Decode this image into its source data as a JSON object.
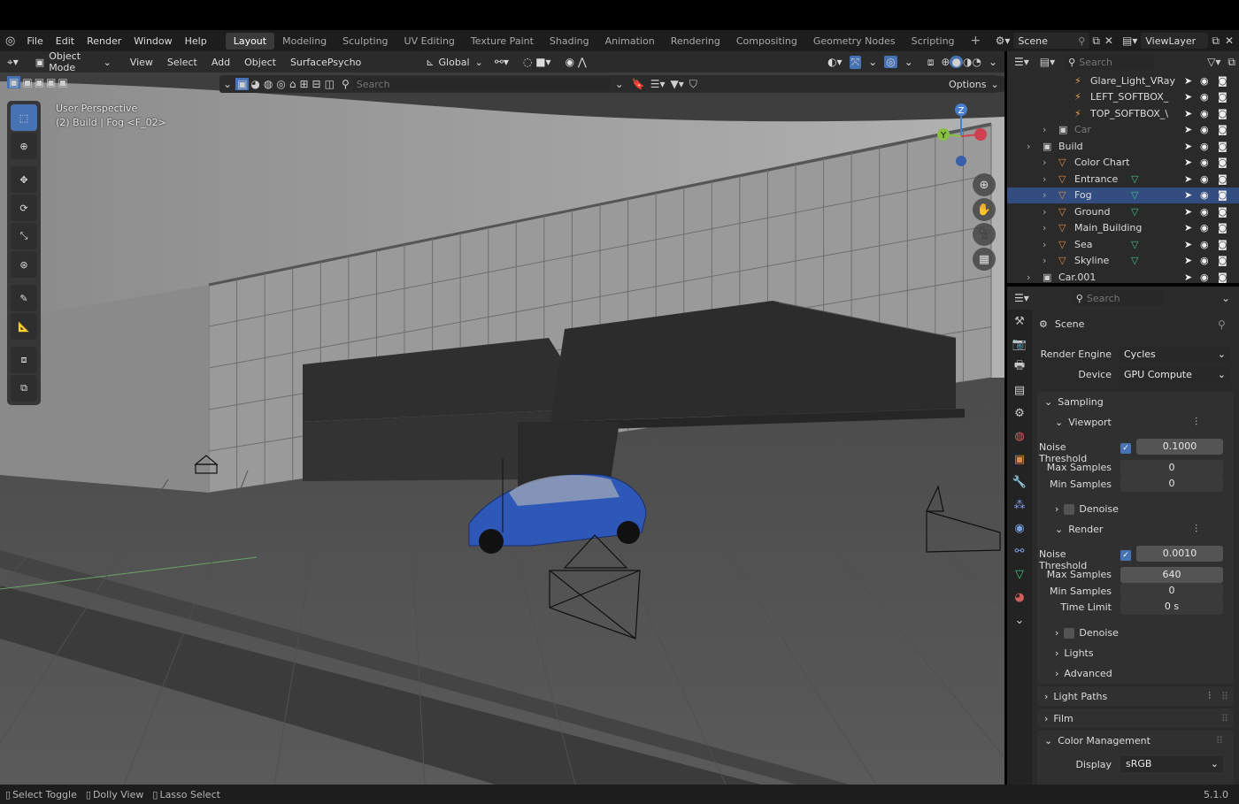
{
  "topbar": {
    "menus": [
      "File",
      "Edit",
      "Render",
      "Window",
      "Help"
    ],
    "workspaces": [
      "Layout",
      "Modeling",
      "Sculpting",
      "UV Editing",
      "Texture Paint",
      "Shading",
      "Animation",
      "Rendering",
      "Compositing",
      "Geometry Nodes",
      "Scripting"
    ],
    "active_workspace": "Layout",
    "scene": "Scene",
    "view_layer": "ViewLayer"
  },
  "viewport_header": {
    "mode": "Object Mode",
    "menus": [
      "View",
      "Select",
      "Add",
      "Object",
      "SurfacePsycho"
    ],
    "transform_orientation": "Global"
  },
  "tool_header": {
    "search_placeholder": "Search",
    "options_label": "Options"
  },
  "viewport": {
    "view_name": "User Perspective",
    "view_info": "(2) Build | Fog <F_02>",
    "gizmo_axes": {
      "z": "Z",
      "y": "Y"
    }
  },
  "outliner": {
    "search_placeholder": "Search",
    "rows": [
      {
        "label": "Glare_Light_VRay",
        "state": "normal"
      },
      {
        "label": "LEFT_SOFTBOX_",
        "state": "normal"
      },
      {
        "label": "TOP_SOFTBOX_\\",
        "state": "normal"
      },
      {
        "label": "Car",
        "state": "dim"
      },
      {
        "label": "Build",
        "state": "normal"
      },
      {
        "label": "Color Chart",
        "state": "normal"
      },
      {
        "label": "Entrance",
        "state": "normal"
      },
      {
        "label": "Fog",
        "state": "selected"
      },
      {
        "label": "Ground",
        "state": "normal"
      },
      {
        "label": "Main_Building",
        "state": "normal"
      },
      {
        "label": "Sea",
        "state": "normal"
      },
      {
        "label": "Skyline",
        "state": "normal"
      },
      {
        "label": "Car.001",
        "state": "normal"
      }
    ]
  },
  "properties": {
    "search_placeholder": "Search",
    "context": "Scene",
    "render_engine_label": "Render Engine",
    "render_engine": "Cycles",
    "device_label": "Device",
    "device": "GPU Compute",
    "sampling": {
      "title": "Sampling",
      "viewport": {
        "title": "Viewport",
        "noise_threshold_label": "Noise Threshold",
        "noise_threshold": "0.1000",
        "noise_threshold_enabled": true,
        "max_samples_label": "Max Samples",
        "max_samples": "0",
        "min_samples_label": "Min Samples",
        "min_samples": "0",
        "denoise_label": "Denoise"
      },
      "render": {
        "title": "Render",
        "noise_threshold_label": "Noise Threshold",
        "noise_threshold": "0.0010",
        "noise_threshold_enabled": true,
        "max_samples_label": "Max Samples",
        "max_samples": "640",
        "min_samples_label": "Min Samples",
        "min_samples": "0",
        "time_limit_label": "Time Limit",
        "time_limit": "0 s",
        "denoise_label": "Denoise"
      },
      "lights_label": "Lights",
      "advanced_label": "Advanced"
    },
    "light_paths_label": "Light Paths",
    "film_label": "Film",
    "color_management": {
      "title": "Color Management",
      "display_label": "Display",
      "display": "sRGB"
    }
  },
  "statusbar": {
    "items": [
      "Select Toggle",
      "Dolly View",
      "Lasso Select"
    ],
    "version": "5.1.0"
  },
  "colors": {
    "accent": "#4772b3",
    "selection": "#334d80",
    "car_paint": "#2e58b8"
  }
}
